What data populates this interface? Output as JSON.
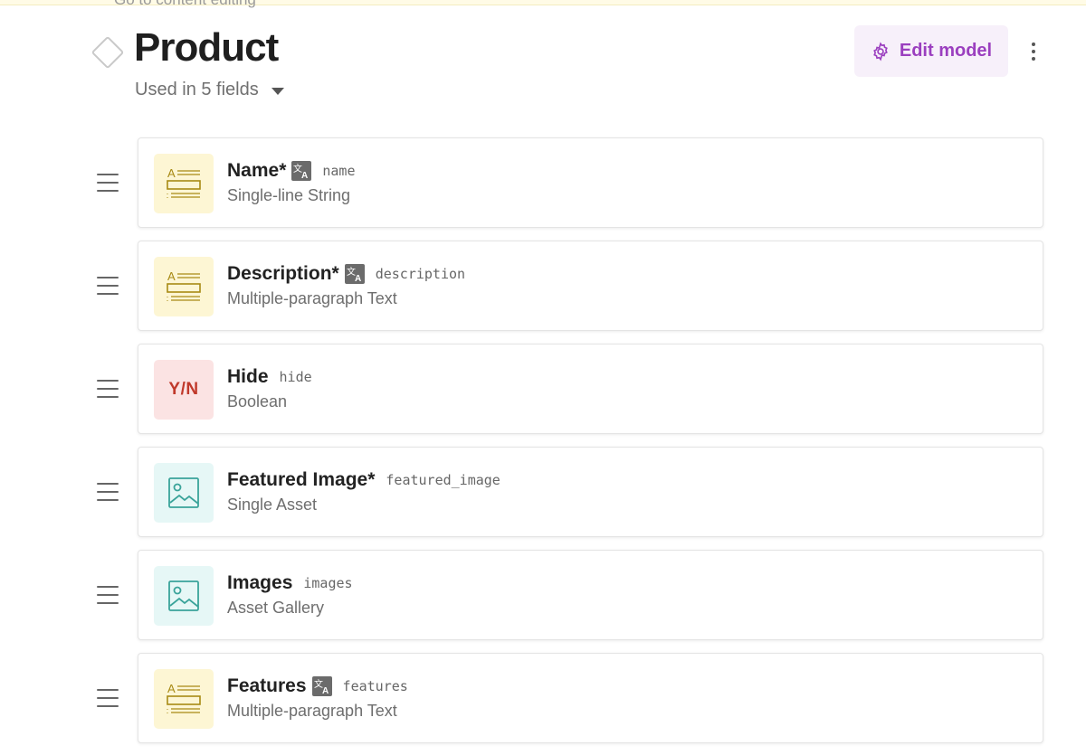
{
  "top_hint": "Go to content editing",
  "header": {
    "title": "Product",
    "used_in": "Used in 5 fields",
    "edit_model_label": "Edit model"
  },
  "colors": {
    "accent": "#9b3fbf",
    "text_icon_bg": "#fdf6d4",
    "bool_icon_bg": "#fbe3e3",
    "asset_icon_bg": "#e6f7f6"
  },
  "fields": [
    {
      "label": "Name*",
      "api_key": "name",
      "type": "Single-line String",
      "icon": "text-field-icon",
      "localized": true
    },
    {
      "label": "Description*",
      "api_key": "description",
      "type": "Multiple-paragraph Text",
      "icon": "text-field-icon",
      "localized": true
    },
    {
      "label": "Hide",
      "api_key": "hide",
      "type": "Boolean",
      "icon": "boolean-icon",
      "icon_text": "Y/N",
      "localized": false
    },
    {
      "label": "Featured Image*",
      "api_key": "featured_image",
      "type": "Single Asset",
      "icon": "image-icon",
      "localized": false
    },
    {
      "label": "Images",
      "api_key": "images",
      "type": "Asset Gallery",
      "icon": "image-icon",
      "localized": false
    },
    {
      "label": "Features",
      "api_key": "features",
      "type": "Multiple-paragraph Text",
      "icon": "text-field-icon",
      "localized": true
    }
  ]
}
